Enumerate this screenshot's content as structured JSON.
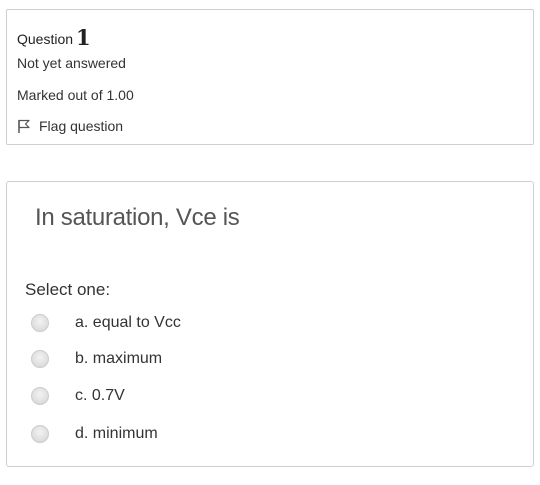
{
  "info": {
    "question_word": "Question",
    "question_number": "1",
    "state": "Not yet answered",
    "grade": "Marked out of 1.00",
    "flag_label": "Flag question"
  },
  "content": {
    "question_text": "In saturation, Vce is",
    "prompt": "Select one:",
    "answers": [
      {
        "label": "a.  equal to Vcc",
        "selected": false
      },
      {
        "label": "b. maximum",
        "selected": false
      },
      {
        "label": "c. 0.7V",
        "selected": false
      },
      {
        "label": "d. minimum",
        "selected": false
      }
    ]
  },
  "icons": {
    "flag": "flag-icon",
    "radio": "radio-icon"
  },
  "colors": {
    "border": "#cfcfcf",
    "question_text": "#555555",
    "text": "#333333"
  }
}
